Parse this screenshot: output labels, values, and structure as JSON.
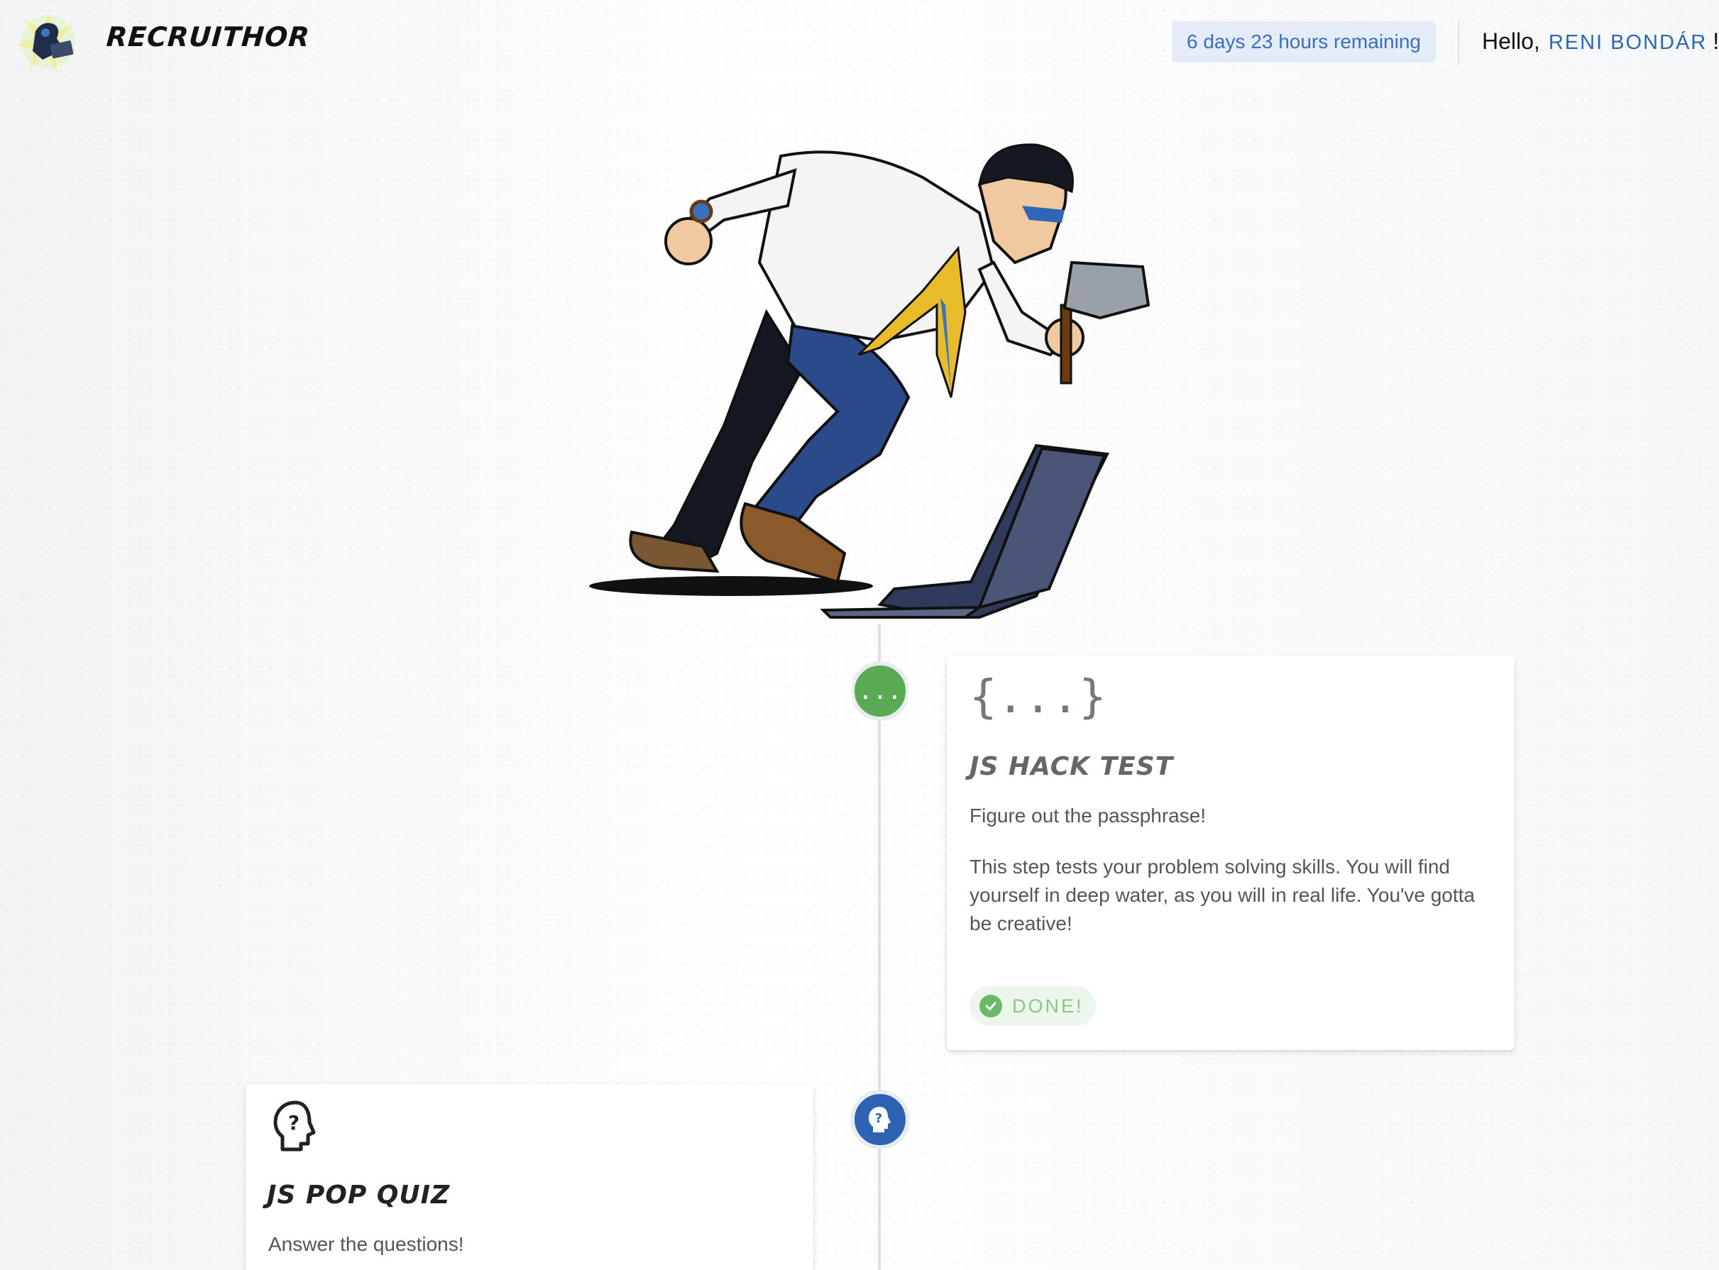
{
  "header": {
    "brand": "RECRUITHOR",
    "timer": "6 days 23 hours remaining",
    "greeting": "Hello,",
    "user_name": "RENI BONDÁR",
    "greeting_suffix": "!"
  },
  "steps": [
    {
      "icon": "{...}",
      "title": "JS HACK TEST",
      "subtitle": "Figure out the passphrase!",
      "description": "This step tests your problem solving skills. You will find yourself in deep water, as you will in real life. You've gotta be creative!",
      "status": "DONE!",
      "node_icon": "{...}",
      "node_color": "#5aaa55"
    },
    {
      "icon": "head-question-icon",
      "title": "JS POP QUIZ",
      "subtitle": "Answer the questions!",
      "node_icon": "head-question-icon",
      "node_color": "#2d63b3"
    }
  ],
  "colors": {
    "accent": "#2f66b8",
    "timer_bg": "#e3ecf8",
    "done_green": "#6bb868"
  }
}
